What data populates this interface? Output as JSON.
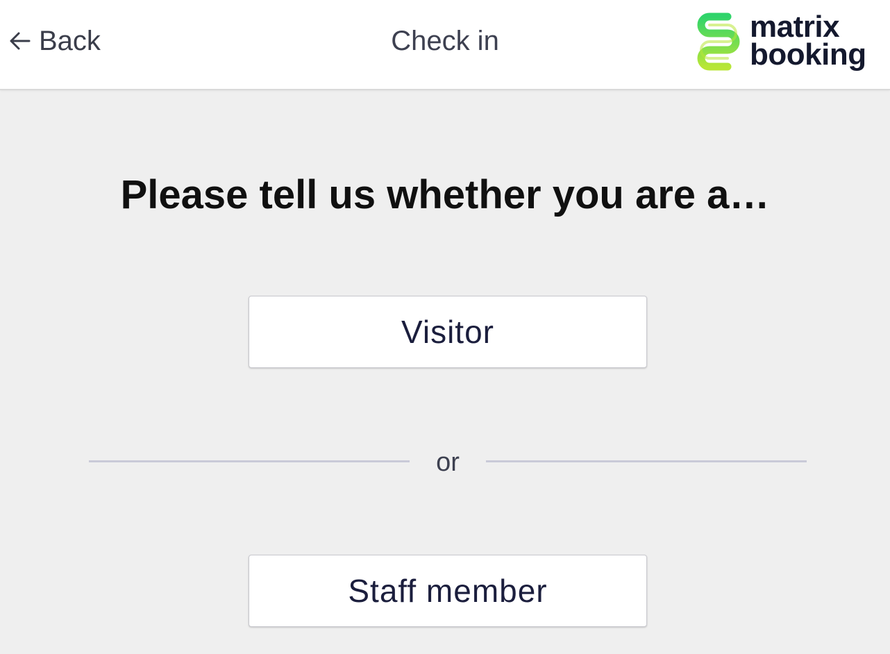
{
  "header": {
    "back_label": "Back",
    "title": "Check in",
    "logo": {
      "line1": "matrix",
      "line2": "booking",
      "mark_icon": "matrix-booking-logo-icon",
      "colors": {
        "green_light": "#b8e637",
        "green": "#2fd46a",
        "text": "#14192e"
      }
    }
  },
  "main": {
    "prompt": "Please tell us whether you are a…",
    "options": [
      {
        "label": "Visitor"
      },
      {
        "label": "Staff member"
      }
    ],
    "divider_text": "or"
  },
  "colors": {
    "background": "#efefef",
    "header_background": "#ffffff",
    "button_text": "#1b1e3d",
    "divider": "#c9cad8"
  }
}
